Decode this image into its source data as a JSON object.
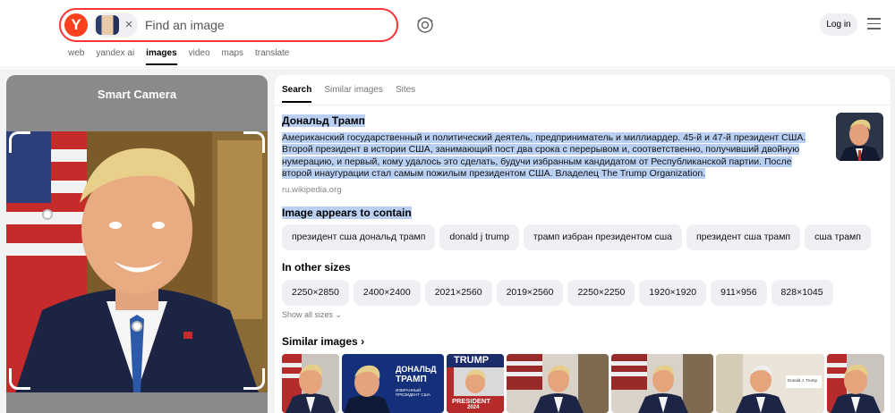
{
  "search": {
    "logo_letter": "Y",
    "placeholder": "Find an image",
    "clear_symbol": "×"
  },
  "nav": {
    "items": [
      {
        "label": "web",
        "active": false
      },
      {
        "label": "yandex ai",
        "active": false
      },
      {
        "label": "images",
        "active": true
      },
      {
        "label": "video",
        "active": false
      },
      {
        "label": "maps",
        "active": false
      },
      {
        "label": "translate",
        "active": false
      }
    ]
  },
  "header": {
    "login_label": "Log in",
    "camera_icon": "camera-search-icon",
    "menu_icon": "hamburger-menu-icon"
  },
  "camera_panel": {
    "title": "Smart Camera"
  },
  "results": {
    "tabs": [
      {
        "label": "Search",
        "active": true
      },
      {
        "label": "Similar images",
        "active": false
      },
      {
        "label": "Sites",
        "active": false
      }
    ],
    "entity": {
      "title": "Дональд Трамп",
      "description": "Американский государственный и политический деятель, предприниматель и миллиардер. 45-й и 47-й президент США. Второй президент в истории США, занимающий пост два срока с перерывом и, соответственно, получивший двойную нумерацию, и первый, кому удалось это сделать, будучи избранным кандидатом от Республиканской партии. После второй инаугурации стал самым пожилым президентом США. Владелец The Trump Organization.",
      "source": "ru.wikipedia.org"
    },
    "contains_title": "Image appears to contain",
    "tags": [
      "президент сша дональд трамп",
      "donald j trump",
      "трамп избран президентом сша",
      "президент сша трамп",
      "сша трамп"
    ],
    "sizes_title": "In other sizes",
    "sizes": [
      "2250×2850",
      "2400×2400",
      "2021×2560",
      "2019×2560",
      "2250×2250",
      "1920×1920",
      "911×956",
      "828×1045"
    ],
    "show_all_label": "Show all sizes",
    "similar_title": "Similar images",
    "similar_thumbs": [
      {
        "kind": "portrait-flag"
      },
      {
        "kind": "banner",
        "line1": "ДОНАЛЬД",
        "line2": "ТРАМП",
        "line3": "ИЗБРАННЫЙ ПРЕЗИДЕНТ США"
      },
      {
        "kind": "poster",
        "top": "TRUMP",
        "bottom": "PRESIDENT",
        "year": "2024"
      },
      {
        "kind": "portrait-house"
      },
      {
        "kind": "portrait-house"
      },
      {
        "kind": "portrait-light",
        "note": "Donald J. Trump"
      },
      {
        "kind": "portrait-flag"
      }
    ]
  },
  "colors": {
    "brand_red": "#fc3f1d",
    "search_border": "#ff3333",
    "selection": "#b9d0f3",
    "chip_bg": "#eef0f3"
  }
}
